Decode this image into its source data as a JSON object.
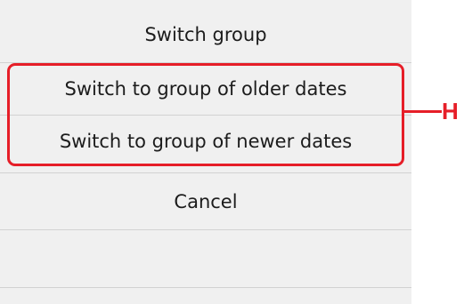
{
  "dialog": {
    "title": "Switch group",
    "options": [
      "Switch to group of older dates",
      "Switch to group of newer dates"
    ],
    "cancel_label": "Cancel"
  },
  "annotation": {
    "label": "H",
    "color": "#e61e28"
  }
}
